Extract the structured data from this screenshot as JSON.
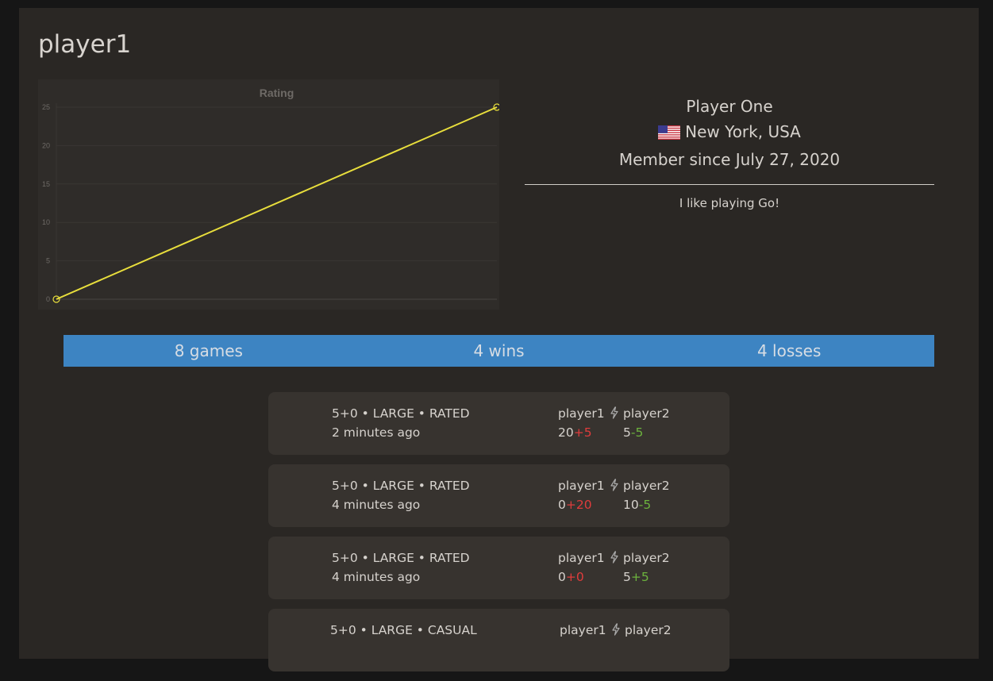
{
  "username": "player1",
  "chart_data": {
    "type": "line",
    "title": "Rating",
    "x": [
      0,
      1
    ],
    "series": [
      {
        "values": [
          0,
          25
        ]
      }
    ],
    "yticks": [
      0,
      5,
      10,
      15,
      20,
      25
    ],
    "ylim": [
      0,
      25
    ],
    "grid": true,
    "line_color": "#e8de3c"
  },
  "profile": {
    "display_name": "Player One",
    "location": "New York, USA",
    "member_since": "Member since July 27, 2020",
    "bio": "I like playing Go!"
  },
  "stats": {
    "games": "8 games",
    "wins": "4 wins",
    "losses": "4 losses"
  },
  "games": [
    {
      "meta": "5+0 • LARGE • RATED",
      "time": "2 minutes ago",
      "p1": "player1",
      "p2": "player2",
      "p1_rating": "20",
      "p1_delta": "+5",
      "p1_delta_color": "red",
      "p2_rating": "5",
      "p2_delta": "-5",
      "p2_delta_color": "green"
    },
    {
      "meta": "5+0 • LARGE • RATED",
      "time": "4 minutes ago",
      "p1": "player1",
      "p2": "player2",
      "p1_rating": "0",
      "p1_delta": "+20",
      "p1_delta_color": "red",
      "p2_rating": "10",
      "p2_delta": "-5",
      "p2_delta_color": "green"
    },
    {
      "meta": "5+0 • LARGE • RATED",
      "time": "4 minutes ago",
      "p1": "player1",
      "p2": "player2",
      "p1_rating": "0",
      "p1_delta": "+0",
      "p1_delta_color": "red",
      "p2_rating": "5",
      "p2_delta": "+5",
      "p2_delta_color": "green"
    },
    {
      "meta": "5+0 • LARGE • CASUAL",
      "time": "",
      "p1": "player1",
      "p2": "player2",
      "p1_rating": "",
      "p1_delta": "",
      "p1_delta_color": "red",
      "p2_rating": "",
      "p2_delta": "",
      "p2_delta_color": "green"
    }
  ],
  "colors": {
    "background": "#161616",
    "panel": "#2a2724",
    "card": "#37332f",
    "stats_bar": "#3d84c2",
    "loss_red": "#e03c3c",
    "win_green": "#6cb33e"
  },
  "icons": {
    "flag": "us-flag-icon",
    "game_type": "lightning-bolt-icon"
  }
}
